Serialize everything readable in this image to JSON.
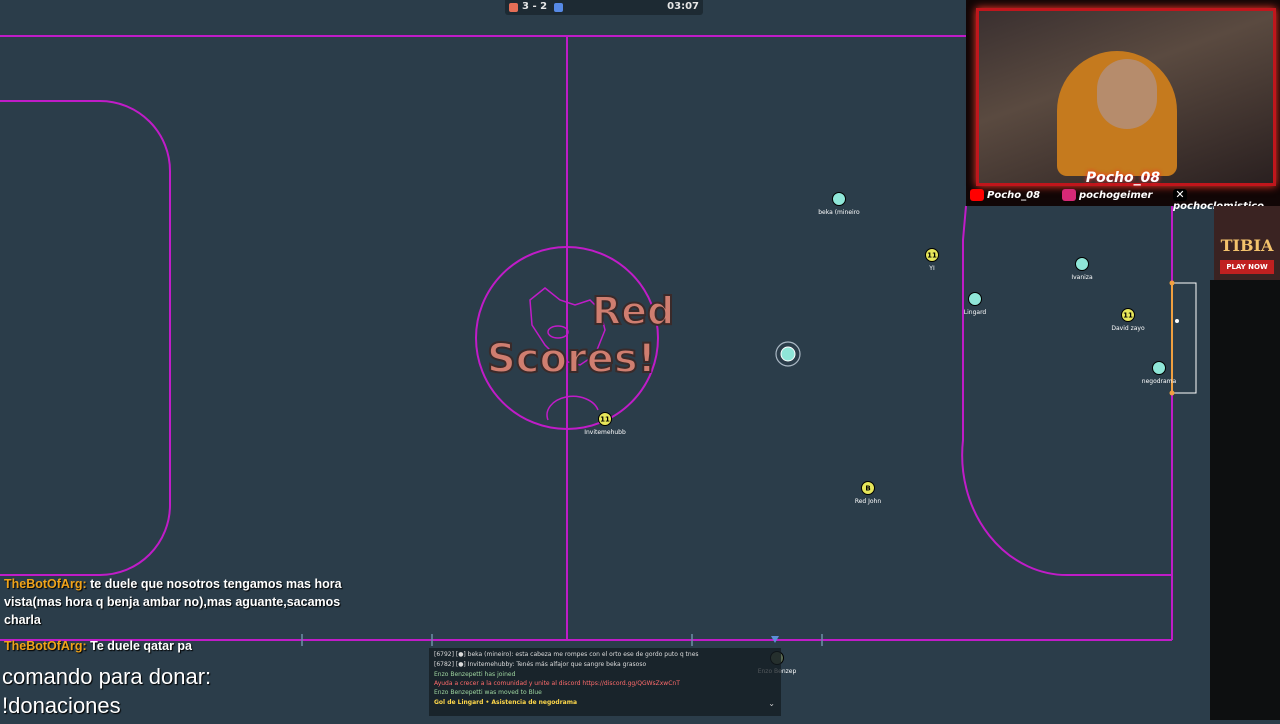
{
  "scoreboard": {
    "score": "3 - 2",
    "time": "03:07",
    "red_color": "#e56e56",
    "blue_color": "#5689e5"
  },
  "banner": {
    "line1": "Red",
    "line2": "Scores!"
  },
  "players": [
    {
      "name": "beka (mineiro",
      "team": "blue",
      "icon": ""
    },
    {
      "name": "YI",
      "team": "red",
      "icon": "11"
    },
    {
      "name": "Ivaniza",
      "team": "blue",
      "icon": ""
    },
    {
      "name": "Lingard",
      "team": "blue",
      "icon": ""
    },
    {
      "name": "David zayo",
      "team": "red",
      "icon": "11"
    },
    {
      "name": "negodrama",
      "team": "blue",
      "icon": ""
    },
    {
      "name": "Invitemehubb",
      "team": "red",
      "icon": "11"
    },
    {
      "name": "Red John",
      "team": "red",
      "icon": "B"
    },
    {
      "name": "Enzo Benzep",
      "team": "spectator",
      "icon": ""
    }
  ],
  "webcam": {
    "streamer": "Pocho_08",
    "youtube": "Pocho_08",
    "instagram": "pochogeimer",
    "x": "pochoclomistico"
  },
  "ad": {
    "title": "TIBIA",
    "button": "PLAY NOW"
  },
  "chat": [
    {
      "user": "TheBotOfArg:",
      "text": "te duele que nosotros tengamos mas hora vista(mas hora q benja ambar no),mas aguante,sacamos charla"
    },
    {
      "user": "TheBotOfArg:",
      "text": "Te duele qatar pa"
    }
  ],
  "donate": {
    "line1": "comando para donar:",
    "line2": "!donaciones"
  },
  "gamelog": [
    {
      "text": "[6792] [●] beka (mineiro): esta cabeza me rompes con el orto ese de gordo puto q tnes",
      "color": "#dcdcdc"
    },
    {
      "text": "[6782] [●] Invitemehubby: Tenés más alfajor que sangre beka grasoso",
      "color": "#dcdcdc"
    },
    {
      "text": "Enzo Benzepetti has joined",
      "color": "#9fd6a0"
    },
    {
      "text": "Ayuda a crecer a la comunidad y unite al discord https://discord.gg/QGWsZxwCnT",
      "color": "#ff6b6b"
    },
    {
      "text": "Enzo Benzepetti was moved to Blue",
      "color": "#9fd6a0"
    },
    {
      "text": "Gol de Lingard • Asistencia de negodrama",
      "color": "#ffd84a"
    }
  ],
  "colors": {
    "field": "#2b3d4a",
    "lines": "#c01cc8",
    "red_player": "#e6e65a",
    "blue_player": "#8fe6d8"
  }
}
